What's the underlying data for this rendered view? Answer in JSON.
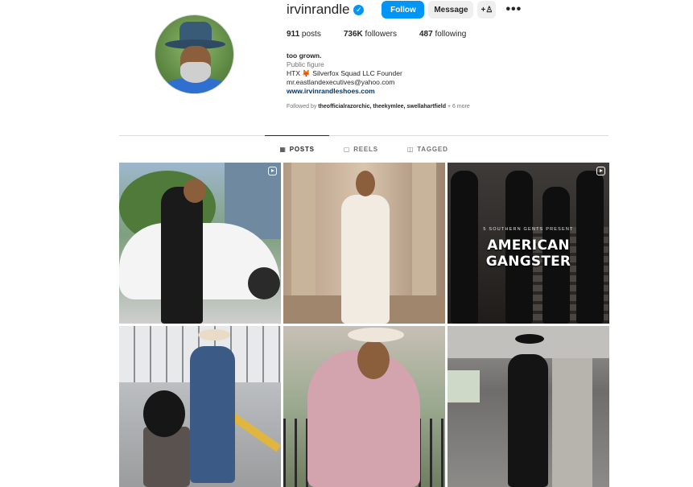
{
  "profile": {
    "username": "irvinrandle",
    "verified_glyph": "✓",
    "follow_label": "Follow",
    "message_label": "Message",
    "add_user_glyph": "+♙",
    "more_glyph": "•••",
    "stats": {
      "posts_count": "911",
      "posts_label": "posts",
      "followers_count": "736K",
      "followers_label": "followers",
      "following_count": "487",
      "following_label": "following"
    },
    "bio": {
      "name": "too grown.",
      "category": "Public figure",
      "line1": "HTX 🦊 Silverfox Squad LLC Founder",
      "line2": "mr.eastlandexecutives@yahoo.com",
      "link": "www.irvinrandleshoes.com"
    },
    "followed_by": {
      "prefix": "Followed by ",
      "names": "theofficialrazorchic, theekymlee, swellahartfield",
      "suffix": " + 6 more"
    }
  },
  "tabs": [
    {
      "icon": "▦",
      "label": "POSTS",
      "active": true
    },
    {
      "icon": "▢",
      "label": "REELS",
      "active": false
    },
    {
      "icon": "◫",
      "label": "TAGGED",
      "active": false
    }
  ],
  "posts": {
    "p3_subtitle": "5 SOUTHERN GENTS PRESENT",
    "p3_title": "AMERICAN GANGSTER"
  },
  "icons": {
    "verified": "verified-badge-icon",
    "add_user": "add-user-icon",
    "more": "more-options-icon",
    "reel": "reel-icon"
  },
  "colors": {
    "accent": "#0095f6",
    "link": "#00376b",
    "muted": "#737373"
  }
}
